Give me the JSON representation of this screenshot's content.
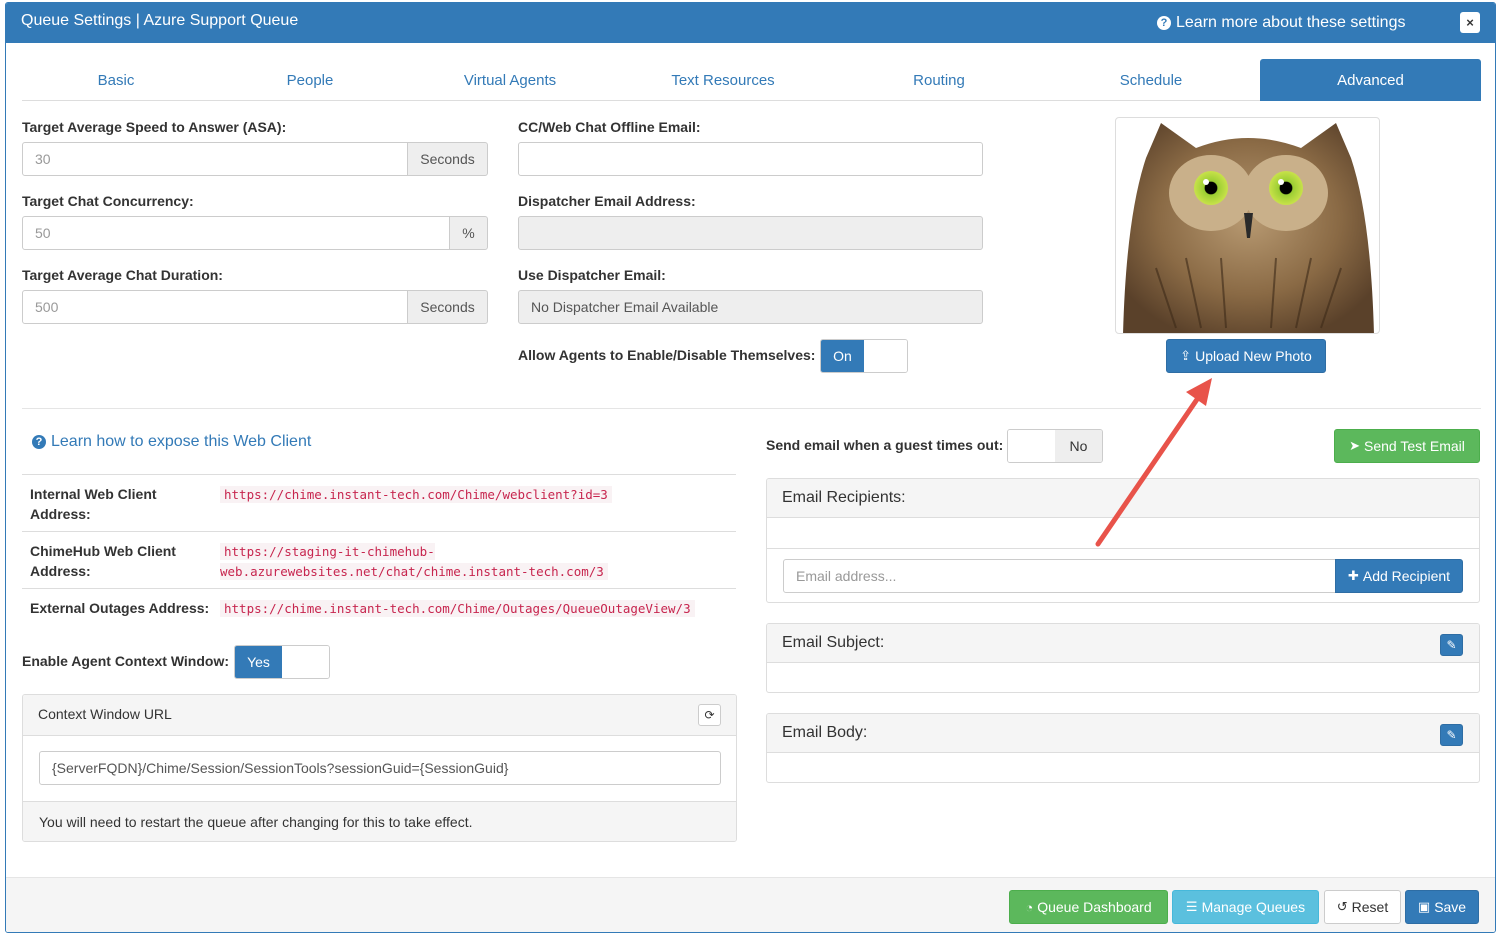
{
  "header": {
    "title": "Queue Settings | Azure Support Queue",
    "learn_more": "Learn more about these settings",
    "close_glyph": "×"
  },
  "tabs": [
    {
      "label": "Basic"
    },
    {
      "label": "People"
    },
    {
      "label": "Virtual Agents"
    },
    {
      "label": "Text Resources"
    },
    {
      "label": "Routing"
    },
    {
      "label": "Schedule"
    },
    {
      "label": "Advanced",
      "active": true
    }
  ],
  "left_form": {
    "asa_label": "Target Average Speed to Answer (ASA):",
    "asa_value": "30",
    "asa_unit": "Seconds",
    "concurrency_label": "Target Chat Concurrency:",
    "concurrency_value": "50",
    "concurrency_unit": "%",
    "duration_label": "Target Average Chat Duration:",
    "duration_value": "500",
    "duration_unit": "Seconds"
  },
  "mid_form": {
    "offline_email_label": "CC/Web Chat Offline Email:",
    "offline_email_value": "",
    "dispatcher_label": "Dispatcher Email Address:",
    "dispatcher_value": "",
    "use_dispatcher_label": "Use Dispatcher Email:",
    "use_dispatcher_value": "No Dispatcher Email Available",
    "allow_agents_label": "Allow Agents to Enable/Disable Themselves:",
    "allow_agents_state": "On"
  },
  "photo": {
    "upload_label": "Upload New Photo"
  },
  "web_client": {
    "learn_link": "Learn how to expose this Web Client",
    "rows": [
      {
        "label": "Internal Web Client Address:",
        "value": "https://chime.instant-tech.com/Chime/webclient?id=3"
      },
      {
        "label": "ChimeHub Web Client Address:",
        "value": "https://staging-it-chimehub-web.azurewebsites.net/chat/chime.instant-tech.com/3"
      },
      {
        "label": "External Outages Address:",
        "value": "https://chime.instant-tech.com/Chime/Outages/QueueOutageView/3"
      }
    ],
    "context_toggle_label": "Enable Agent Context Window:",
    "context_toggle_state": "Yes"
  },
  "context_panel": {
    "title": "Context Window URL",
    "url_value": "{ServerFQDN}/Chime/Session/SessionTools?sessionGuid={SessionGuid}",
    "note": "You will need to restart the queue after changing for this to take effect."
  },
  "email": {
    "timeout_label": "Send email when a guest times out:",
    "timeout_state": "No",
    "send_test_label": "Send Test Email",
    "recipients_title": "Email Recipients:",
    "email_placeholder": "Email address...",
    "add_recipient_label": "Add Recipient",
    "subject_title": "Email Subject:",
    "body_title": "Email Body:"
  },
  "footer": {
    "dashboard_label": "Queue Dashboard",
    "manage_label": "Manage Queues",
    "reset_label": "Reset",
    "save_label": "Save"
  },
  "colors": {
    "primary": "#337ab7",
    "success": "#5cb85c",
    "info": "#5bc0de",
    "code": "#c7254e",
    "annotation_arrow": "#e8534a"
  }
}
